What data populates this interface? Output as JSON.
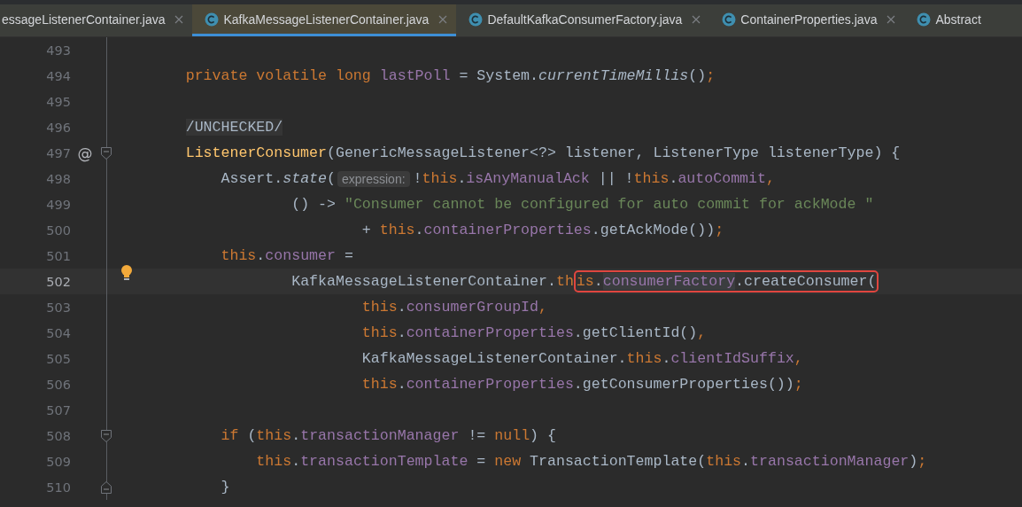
{
  "tabs": [
    {
      "label": "essageListenerContainer.java",
      "selected": false,
      "icon": false,
      "closable": true
    },
    {
      "label": "KafkaMessageListenerContainer.java",
      "selected": true,
      "icon": true,
      "closable": true
    },
    {
      "label": "DefaultKafkaConsumerFactory.java",
      "selected": false,
      "icon": true,
      "closable": true
    },
    {
      "label": "ContainerProperties.java",
      "selected": false,
      "icon": true,
      "closable": true
    },
    {
      "label": "Abstract",
      "selected": false,
      "icon": true,
      "closable": false
    }
  ],
  "editor": {
    "lines": [
      {
        "number": "493",
        "current": false
      },
      {
        "number": "494",
        "current": false,
        "tokens": [
          {
            "text": "        private volatile long",
            "kind": "keyword"
          },
          {
            "text": " lastPoll",
            "kind": "field"
          },
          {
            "text": " = System.",
            "kind": "plain"
          },
          {
            "text": "currentTimeMillis",
            "kind": "static"
          },
          {
            "text": "()",
            "kind": "plain"
          },
          {
            "text": ";",
            "kind": "keyword"
          }
        ]
      },
      {
        "number": "495",
        "current": false
      },
      {
        "number": "496",
        "current": false,
        "tokens": [
          {
            "text": "        /UNCHECKED/",
            "kind": "folded"
          }
        ]
      },
      {
        "number": "497",
        "current": false,
        "gutter_mark": "@",
        "fold_start": true,
        "tokens": [
          {
            "text": "        ListenerConsumer",
            "kind": "decl"
          },
          {
            "text": "(GenericMessageListener<?> listener, ListenerType listenerType) {",
            "kind": "plain"
          }
        ]
      },
      {
        "number": "498",
        "current": false,
        "tokens": [
          {
            "text": "            Assert.",
            "kind": "plain"
          },
          {
            "text": "state",
            "kind": "static"
          },
          {
            "text": "(",
            "kind": "plain"
          },
          {
            "text": "expression:",
            "kind": "hint"
          },
          {
            "text": "!",
            "kind": "plain"
          },
          {
            "text": "this",
            "kind": "keyword"
          },
          {
            "text": ".",
            "kind": "plain"
          },
          {
            "text": "isAnyManualAck",
            "kind": "field"
          },
          {
            "text": " || !",
            "kind": "plain"
          },
          {
            "text": "this",
            "kind": "keyword"
          },
          {
            "text": ".",
            "kind": "plain"
          },
          {
            "text": "autoCommit",
            "kind": "field"
          },
          {
            "text": ",",
            "kind": "keyword"
          }
        ]
      },
      {
        "number": "499",
        "current": false,
        "tokens": [
          {
            "text": "                    () -> ",
            "kind": "plain"
          },
          {
            "text": "\"Consumer cannot be configured for auto commit for ackMode \"",
            "kind": "string"
          }
        ]
      },
      {
        "number": "500",
        "current": false,
        "tokens": [
          {
            "text": "                            + ",
            "kind": "plain"
          },
          {
            "text": "this",
            "kind": "keyword"
          },
          {
            "text": ".",
            "kind": "plain"
          },
          {
            "text": "containerProperties",
            "kind": "field"
          },
          {
            "text": ".getAckMode())",
            "kind": "plain"
          },
          {
            "text": ";",
            "kind": "keyword"
          }
        ]
      },
      {
        "number": "501",
        "current": false,
        "tokens": [
          {
            "text": "            this",
            "kind": "keyword"
          },
          {
            "text": ".",
            "kind": "plain"
          },
          {
            "text": "consumer",
            "kind": "field"
          },
          {
            "text": " =",
            "kind": "plain"
          }
        ]
      },
      {
        "number": "502",
        "current": true,
        "bulb": true,
        "tokens": [
          {
            "text": "                    KafkaMessageListenerContainer.",
            "kind": "plain",
            "boxed": false
          },
          {
            "text": "th",
            "kind": "keyword",
            "boxed": false
          },
          {
            "text": "is",
            "kind": "keyword",
            "boxed": true
          },
          {
            "text": ".",
            "kind": "plain",
            "boxed": true
          },
          {
            "text": "consumerFactory",
            "kind": "usage",
            "boxed": true
          },
          {
            "text": ".createConsumer(",
            "kind": "plain",
            "boxed": true
          }
        ]
      },
      {
        "number": "503",
        "current": false,
        "tokens": [
          {
            "text": "                            this",
            "kind": "keyword"
          },
          {
            "text": ".",
            "kind": "plain"
          },
          {
            "text": "consumerGroupId",
            "kind": "field"
          },
          {
            "text": ",",
            "kind": "keyword"
          }
        ]
      },
      {
        "number": "504",
        "current": false,
        "tokens": [
          {
            "text": "                            this",
            "kind": "keyword"
          },
          {
            "text": ".",
            "kind": "plain"
          },
          {
            "text": "containerProperties",
            "kind": "field"
          },
          {
            "text": ".getClientId()",
            "kind": "plain"
          },
          {
            "text": ",",
            "kind": "keyword"
          }
        ]
      },
      {
        "number": "505",
        "current": false,
        "tokens": [
          {
            "text": "                            KafkaMessageListenerContainer.",
            "kind": "plain"
          },
          {
            "text": "this",
            "kind": "keyword"
          },
          {
            "text": ".",
            "kind": "plain"
          },
          {
            "text": "clientIdSuffix",
            "kind": "field"
          },
          {
            "text": ",",
            "kind": "keyword"
          }
        ]
      },
      {
        "number": "506",
        "current": false,
        "tokens": [
          {
            "text": "                            this",
            "kind": "keyword"
          },
          {
            "text": ".",
            "kind": "plain"
          },
          {
            "text": "containerProperties",
            "kind": "field"
          },
          {
            "text": ".getConsumerProperties())",
            "kind": "plain"
          },
          {
            "text": ";",
            "kind": "keyword"
          }
        ]
      },
      {
        "number": "507",
        "current": false
      },
      {
        "number": "508",
        "current": false,
        "fold_start": true,
        "tokens": [
          {
            "text": "            if",
            "kind": "keyword"
          },
          {
            "text": " (",
            "kind": "plain"
          },
          {
            "text": "this",
            "kind": "keyword"
          },
          {
            "text": ".",
            "kind": "plain"
          },
          {
            "text": "transactionManager",
            "kind": "field"
          },
          {
            "text": " != ",
            "kind": "plain"
          },
          {
            "text": "null",
            "kind": "keyword"
          },
          {
            "text": ") {",
            "kind": "plain"
          }
        ]
      },
      {
        "number": "509",
        "current": false,
        "tokens": [
          {
            "text": "                this",
            "kind": "keyword"
          },
          {
            "text": ".",
            "kind": "plain"
          },
          {
            "text": "transactionTemplate",
            "kind": "field"
          },
          {
            "text": " = ",
            "kind": "plain"
          },
          {
            "text": "new",
            "kind": "keyword"
          },
          {
            "text": " TransactionTemplate(",
            "kind": "plain"
          },
          {
            "text": "this",
            "kind": "keyword"
          },
          {
            "text": ".",
            "kind": "plain"
          },
          {
            "text": "transactionManager",
            "kind": "field"
          },
          {
            "text": ")",
            "kind": "plain"
          },
          {
            "text": ";",
            "kind": "keyword"
          }
        ]
      },
      {
        "number": "510",
        "current": false,
        "fold_end": true,
        "tokens": [
          {
            "text": "            }",
            "kind": "plain"
          }
        ]
      }
    ]
  }
}
